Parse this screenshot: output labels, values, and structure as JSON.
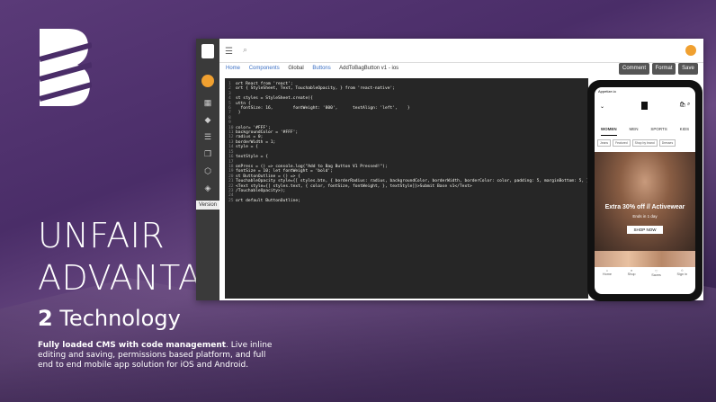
{
  "slide": {
    "title_line1": "UNFAIR",
    "title_line2": "ADVANTAGE",
    "subtitle_number": "2",
    "subtitle_text": "Technology",
    "desc_bold": "Fully loaded CMS with code management",
    "desc_rest": ". Live inline editing and saving, permissions based platform, and full end to end mobile app solution for iOS and Android."
  },
  "cms": {
    "breadcrumbs": [
      "Home",
      "Components",
      "Global",
      "Buttons",
      "AddToBagButton v1 - ios"
    ],
    "buttons": {
      "comment": "Comment",
      "format": "Format",
      "save": "Save"
    },
    "sidebar_version": "Version",
    "code_lines": [
      {
        "n": "1",
        "t": "ort React from 'react';"
      },
      {
        "n": "2",
        "t": "ort { StyleSheet, Text, TouchableOpacity, } from 'react-native';"
      },
      {
        "n": "3",
        "t": ""
      },
      {
        "n": "4",
        "t": "st styles = StyleSheet.create({"
      },
      {
        "n": "5",
        "t": "uttn {"
      },
      {
        "n": "6",
        "t": "  fontSize: 16,        fontWeight: '800',      textAlign: 'left',    }"
      },
      {
        "n": "7",
        "t": " }"
      },
      {
        "n": "8",
        "t": ""
      },
      {
        "n": "9",
        "t": ""
      },
      {
        "n": "10",
        "t": "color= '#FFF';"
      },
      {
        "n": "11",
        "t": "backgroundColor = '#FFF';"
      },
      {
        "n": "12",
        "t": "radius = 0;"
      },
      {
        "n": "13",
        "t": "borderWidth = 1;"
      },
      {
        "n": "14",
        "t": "style = {"
      },
      {
        "n": "15",
        "t": ""
      },
      {
        "n": "16",
        "t": "textStyle = {"
      },
      {
        "n": "17",
        "t": ""
      },
      {
        "n": "18",
        "t": "onPress = () => console.log(\"Add to Bag Button V1 Pressed!\");"
      },
      {
        "n": "19",
        "t": "fontSize = 10; let fontWeight = 'bold';"
      },
      {
        "n": "20",
        "t": "st ButtonOutline = () => {"
      },
      {
        "n": "21",
        "t": "TouchableOpacity style={[ styles.btn, { borderRadius: radius, backgroundColor, borderWidth, borderColor: color, padding: 5, marginBottom: 5, }, sty"
      },
      {
        "n": "22",
        "t": "<Text style={[ styles.text, { color, fontSize, fontWeight, }, textStyle]}>Submit Base v1</Text>"
      },
      {
        "n": "23",
        "t": "/TouchableOpacity>);"
      },
      {
        "n": "24",
        "t": ""
      },
      {
        "n": "25",
        "t": "ort default ButtonOutline;"
      }
    ]
  },
  "phone": {
    "status": "Appetize.io",
    "tabs": [
      "WOMEN",
      "MEN",
      "SPORTS",
      "KIDS"
    ],
    "chips": [
      "Jeans",
      "Featured",
      "Shop by brand",
      "Dresses"
    ],
    "hero_title": "Extra 30% off // Activewear",
    "hero_sub": "Ends in 1 day",
    "hero_button": "SHOP NOW",
    "nav": [
      "Home",
      "Shop",
      "Saves",
      "Sign in"
    ]
  }
}
